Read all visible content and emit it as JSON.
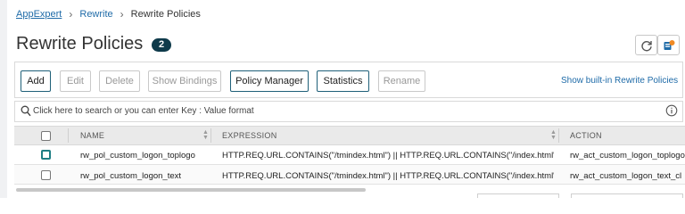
{
  "breadcrumb": {
    "items": [
      "AppExpert",
      "Rewrite",
      "Rewrite Policies"
    ]
  },
  "page": {
    "title": "Rewrite Policies",
    "count": "2"
  },
  "toolbar": {
    "add": "Add",
    "edit": "Edit",
    "delete": "Delete",
    "show_bindings": "Show Bindings",
    "policy_manager": "Policy Manager",
    "statistics": "Statistics",
    "rename": "Rename",
    "show_builtin": "Show built-in Rewrite Policies"
  },
  "search": {
    "placeholder": "Click here to search or you can enter Key : Value format"
  },
  "table": {
    "columns": [
      "NAME",
      "EXPRESSION",
      "ACTION"
    ],
    "rows": [
      {
        "name": "rw_pol_custom_logon_toplogo",
        "expression": "HTTP.REQ.URL.CONTAINS(\"/tmindex.html\") || HTTP.REQ.URL.CONTAINS(\"/index.html\")",
        "action": "rw_act_custom_logon_toplogo"
      },
      {
        "name": "rw_pol_custom_logon_text",
        "expression": "HTTP.REQ.URL.CONTAINS(\"/tmindex.html\") || HTTP.REQ.URL.CONTAINS(\"/index.html\")",
        "action": "rw_act_custom_logon_text_cl"
      }
    ]
  },
  "colors": {
    "link": "#1f6ba8",
    "badge": "#0e3a4a",
    "accent_orange": "#f08a24",
    "checkbox_teal": "#1e7e84"
  },
  "icons": [
    "refresh-icon",
    "orange-notification-icon",
    "search-icon",
    "info-icon"
  ]
}
